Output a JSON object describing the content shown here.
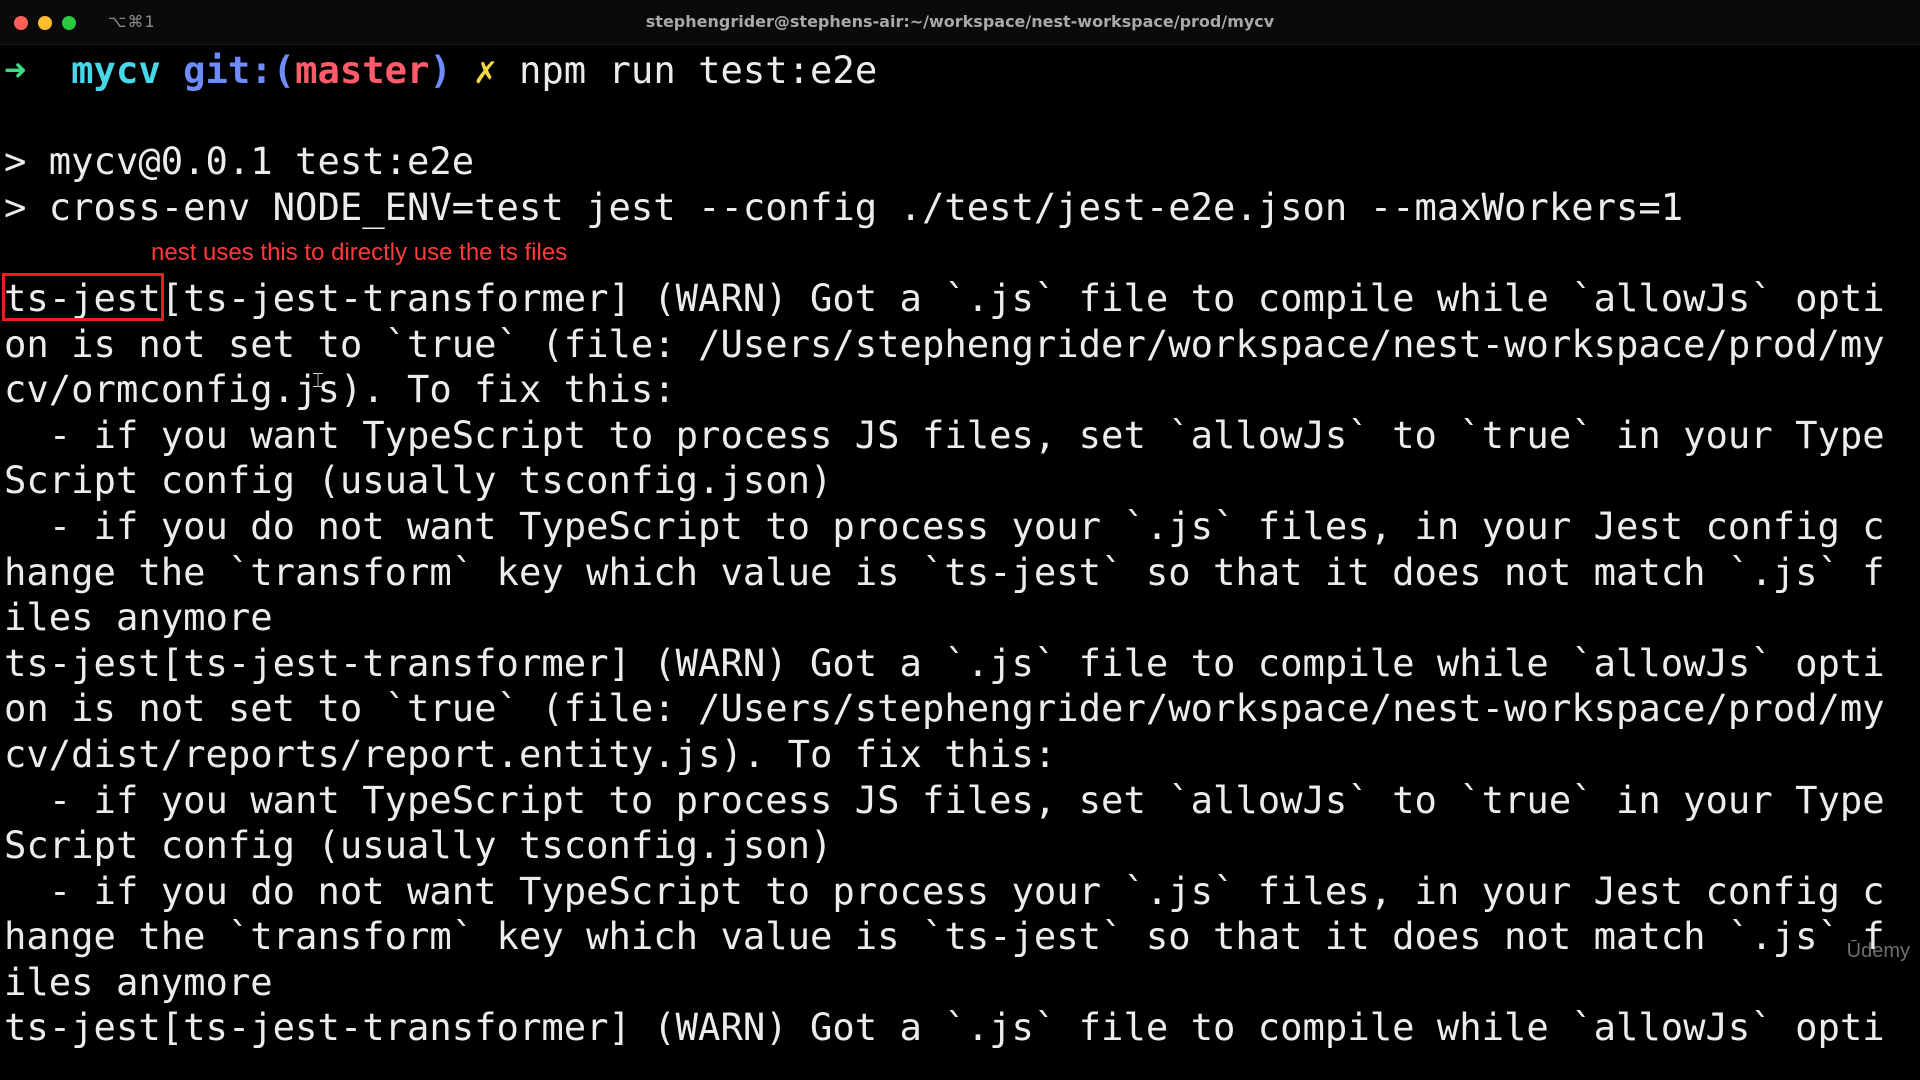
{
  "window": {
    "title": "stephengrider@stephens-air:~/workspace/nest-workspace/prod/mycv",
    "shortcut": "⌥⌘1",
    "traffic_colors": [
      "#ff5f57",
      "#febc2e",
      "#28c840"
    ]
  },
  "prompt": {
    "arrow": "➜",
    "dir": "mycv",
    "git_label": "git:(",
    "branch": "master",
    "git_close": ")",
    "dirty": "✗",
    "command": "npm run test:e2e"
  },
  "lines": [
    "",
    "> mycv@0.0.1 test:e2e",
    "> cross-env NODE_ENV=test jest --config ./test/jest-e2e.json --maxWorkers=1",
    "",
    "ts-jest[ts-jest-transformer] (WARN) Got a `.js` file to compile while `allowJs` opti",
    "on is not set to `true` (file: /Users/stephengrider/workspace/nest-workspace/prod/my",
    "cv/ormconfig.js). To fix this:",
    "  - if you want TypeScript to process JS files, set `allowJs` to `true` in your Type",
    "Script config (usually tsconfig.json)",
    "  - if you do not want TypeScript to process your `.js` files, in your Jest config c",
    "hange the `transform` key which value is `ts-jest` so that it does not match `.js` f",
    "iles anymore",
    "ts-jest[ts-jest-transformer] (WARN) Got a `.js` file to compile while `allowJs` opti",
    "on is not set to `true` (file: /Users/stephengrider/workspace/nest-workspace/prod/my",
    "cv/dist/reports/report.entity.js). To fix this:",
    "  - if you want TypeScript to process JS files, set `allowJs` to `true` in your Type",
    "Script config (usually tsconfig.json)",
    "  - if you do not want TypeScript to process your `.js` files, in your Jest config c",
    "hange the `transform` key which value is `ts-jest` so that it does not match `.js` f",
    "iles anymore",
    "ts-jest[ts-jest-transformer] (WARN) Got a `.js` file to compile while `allowJs` opti"
  ],
  "annotation": {
    "text": "nest uses this to directly use the ts files",
    "color": "#ff3a3a"
  },
  "watermark": "Ūdemy"
}
